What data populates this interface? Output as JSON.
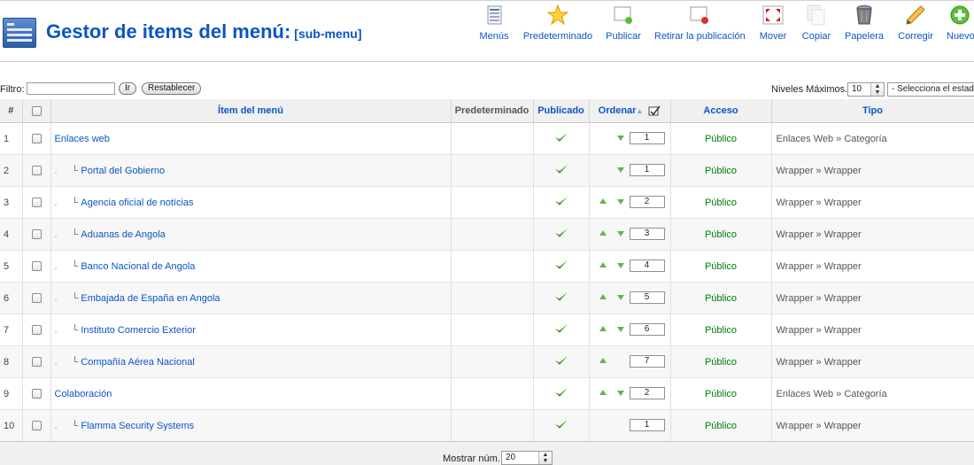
{
  "header": {
    "title": "Gestor de items del menú:",
    "subtitle": "[sub-menu]"
  },
  "toolbar": {
    "buttons": [
      {
        "label": "Menús",
        "icon": "menus-icon"
      },
      {
        "label": "Predeterminado",
        "icon": "star-icon"
      },
      {
        "label": "Publicar",
        "icon": "publish-icon"
      },
      {
        "label": "Retirar la publicación",
        "icon": "unpublish-icon"
      },
      {
        "label": "Mover",
        "icon": "move-icon"
      },
      {
        "label": "Copiar",
        "icon": "copy-icon"
      },
      {
        "label": "Papelera",
        "icon": "trash-icon"
      },
      {
        "label": "Corregir",
        "icon": "edit-icon"
      },
      {
        "label": "Nuevo",
        "icon": "new-icon"
      }
    ]
  },
  "filter": {
    "label": "Filtro:",
    "value": "",
    "go_label": "Ir",
    "reset_label": "Restablecer",
    "levels_label": "Niveles Máximos.",
    "levels_value": "10",
    "state_value": "- Selecciona el estado -"
  },
  "table": {
    "columns": {
      "num": "#",
      "item": "Ítem del menú",
      "default": "Predeterminado",
      "published": "Publicado",
      "order": "Ordenar",
      "access": "Acceso",
      "type": "Tipo"
    },
    "rows": [
      {
        "num": "1",
        "name": "Enlaces web",
        "child": false,
        "order": "1",
        "up": false,
        "down": true,
        "access": "Público",
        "type": "Enlaces Web » Categoría"
      },
      {
        "num": "2",
        "name": "Portal del Gobierno",
        "child": true,
        "order": "1",
        "up": false,
        "down": true,
        "access": "Público",
        "type": "Wrapper » Wrapper"
      },
      {
        "num": "3",
        "name": "Agencia oficial de notícias",
        "child": true,
        "order": "2",
        "up": true,
        "down": true,
        "access": "Público",
        "type": "Wrapper » Wrapper"
      },
      {
        "num": "4",
        "name": "Aduanas de Angola",
        "child": true,
        "order": "3",
        "up": true,
        "down": true,
        "access": "Público",
        "type": "Wrapper » Wrapper"
      },
      {
        "num": "5",
        "name": "Banco Nacional de Angola",
        "child": true,
        "order": "4",
        "up": true,
        "down": true,
        "access": "Público",
        "type": "Wrapper » Wrapper"
      },
      {
        "num": "6",
        "name": "Embajada de España en Angola",
        "child": true,
        "order": "5",
        "up": true,
        "down": true,
        "access": "Público",
        "type": "Wrapper » Wrapper"
      },
      {
        "num": "7",
        "name": "Instituto Comercio Exterior",
        "child": true,
        "order": "6",
        "up": true,
        "down": true,
        "access": "Público",
        "type": "Wrapper » Wrapper"
      },
      {
        "num": "8",
        "name": "Compañía Aérea Nacional",
        "child": true,
        "order": "7",
        "up": true,
        "down": false,
        "access": "Público",
        "type": "Wrapper » Wrapper"
      },
      {
        "num": "9",
        "name": "Colaboración",
        "child": false,
        "order": "2",
        "up": true,
        "down": true,
        "access": "Público",
        "type": "Enlaces Web » Categoría"
      },
      {
        "num": "10",
        "name": "Flamma Security Systems",
        "child": true,
        "order": "1",
        "up": false,
        "down": false,
        "access": "Público",
        "type": "Wrapper » Wrapper"
      }
    ]
  },
  "footer": {
    "show_label": "Mostrar núm.",
    "show_value": "20"
  },
  "colors": {
    "link": "#0b55c4",
    "access_green": "#008000",
    "arrow_green": "#6cb33e"
  }
}
